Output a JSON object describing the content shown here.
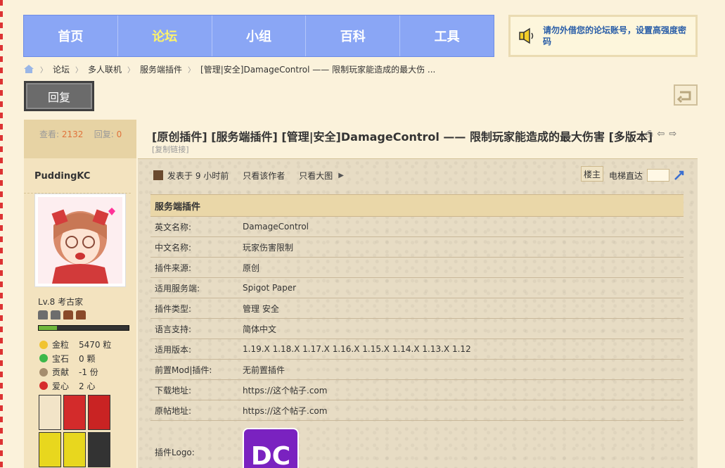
{
  "nav": {
    "items": [
      {
        "label": "首页",
        "active": false
      },
      {
        "label": "论坛",
        "active": true
      },
      {
        "label": "小组",
        "active": false
      },
      {
        "label": "百科",
        "active": false
      },
      {
        "label": "工具",
        "active": false
      }
    ],
    "notice": "请勿外借您的论坛账号，设置高强度密码"
  },
  "breadcrumb": [
    "论坛",
    "多人联机",
    "服务端插件",
    "[管理|安全]DamageControl —— 限制玩家能造成的最大伤 ..."
  ],
  "reply_label": "回复",
  "stats": {
    "views_label": "查看:",
    "views": "2132",
    "replies_label": "回复:",
    "replies": "0"
  },
  "author": {
    "name": "PuddingKC",
    "level": "Lv.8 考古家",
    "exp_fraction": 0.2,
    "items": [
      {
        "label": "金粒",
        "value": "5470 粒",
        "color": "#f0c330"
      },
      {
        "label": "宝石",
        "value": "0 颗",
        "color": "#3cb84b"
      },
      {
        "label": "贡献",
        "value": "-1 份",
        "color": "#a58d6e"
      },
      {
        "label": "爱心",
        "value": "2 心",
        "color": "#d62b2b"
      }
    ]
  },
  "post": {
    "title": "[原创插件] [服务端插件] [管理|安全]DamageControl —— 限制玩家能造成的最大伤害 [多版本]",
    "copy_link": "[复制链接]",
    "meta": {
      "posted": "发表于 9 小时前",
      "author_only": "只看该作者",
      "big_image": "只看大图",
      "floor": "楼主",
      "jump": "电梯直达"
    },
    "table": {
      "header": "服务端插件",
      "rows": [
        {
          "k": "英文名称:",
          "v": "DamageControl"
        },
        {
          "k": "中文名称:",
          "v": "玩家伤害限制"
        },
        {
          "k": "插件来源:",
          "v": "原创"
        },
        {
          "k": "适用服务端:",
          "v": "Spigot Paper"
        },
        {
          "k": "插件类型:",
          "v": "管理 安全"
        },
        {
          "k": "语言支持:",
          "v": "简体中文"
        },
        {
          "k": "适用版本:",
          "v": "1.19.X 1.18.X 1.17.X 1.16.X 1.15.X 1.14.X 1.13.X 1.12"
        },
        {
          "k": "前置Mod|插件:",
          "v": "无前置插件"
        },
        {
          "k": "下载地址:",
          "v": "https://这个帖子.com"
        },
        {
          "k": "原帖地址:",
          "v": "https://这个帖子.com"
        }
      ],
      "logo_label": "插件Logo:",
      "logo_text": "DC"
    }
  }
}
